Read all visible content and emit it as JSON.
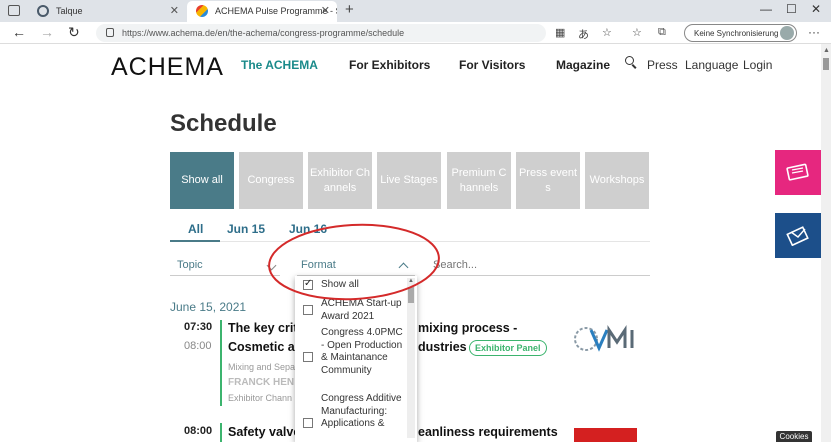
{
  "browser": {
    "tabs": [
      {
        "title": "Talque"
      },
      {
        "title": "ACHEMA Pulse Programme - Sch"
      }
    ],
    "url": "https://www.achema.de/en/the-achema/congress-programme/schedule",
    "sync_label": "Keine Synchronisierung"
  },
  "site": {
    "logo": "ACHEMA",
    "nav": [
      "The ACHEMA",
      "For Exhibitors",
      "For Visitors",
      "Magazine"
    ],
    "nav_right": [
      "Press",
      "Language",
      "Login"
    ]
  },
  "page": {
    "title": "Schedule",
    "categories": [
      "Show all",
      "Congress",
      "Exhibitor Channels",
      "Live Stages",
      "Premium Channels",
      "Press events",
      "Workshops"
    ],
    "day_tabs": [
      "All",
      "Jun 15",
      "Jun 16"
    ],
    "filters": {
      "topic": "Topic",
      "format": "Format",
      "search_placeholder": "Search..."
    },
    "format_options": [
      {
        "label": "Show all",
        "checked": true
      },
      {
        "label": "ACHEMA Start-up Award 2021",
        "checked": false
      },
      {
        "label": "Congress 4.0PMC - Open Production & Maintanance Community",
        "checked": false
      },
      {
        "label": "Congress Additive Manufacturing: Applications &",
        "checked": false
      }
    ],
    "date_header": "June 15, 2021",
    "events": [
      {
        "start": "07:30",
        "end": "08:00",
        "title_line1": "The key crit",
        "title_line1_tail": "mixing process -",
        "title_line2": "Cosmetic ar",
        "title_line2_tail": "dustries",
        "badge": "Exhibitor Panel",
        "meta": "Mixing and Sepa",
        "speaker": "FRANCK HEN",
        "channel": "Exhibitor Chann"
      },
      {
        "start": "08:00",
        "title": "Safety valve",
        "title_tail": "eanliness requirements"
      }
    ],
    "cookies": "Cookies"
  },
  "colors": {
    "accent": "#4a7b88",
    "nav_active": "#1a8a8a",
    "badge_green": "#3cb46e",
    "side_pink": "#e6277f",
    "side_blue": "#1c4f8a",
    "annotation": "#d42a2a"
  }
}
